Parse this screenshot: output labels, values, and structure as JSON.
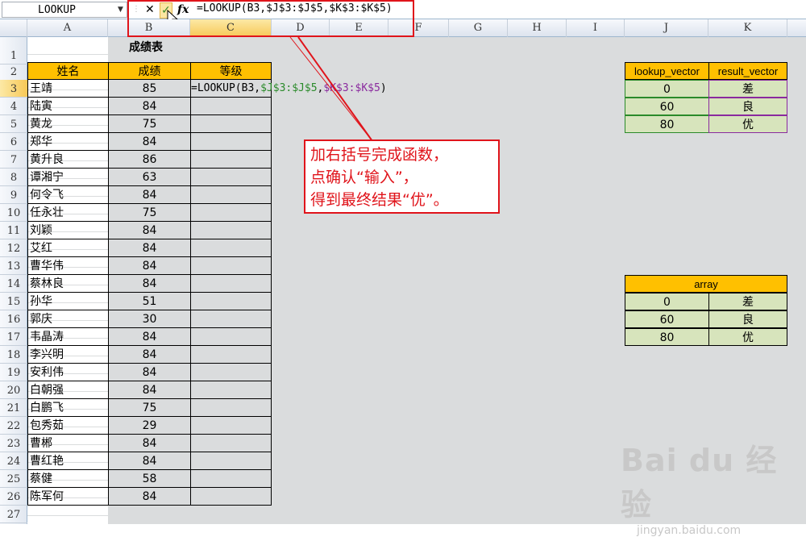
{
  "formula_bar": {
    "name_box": "LOOKUP",
    "formula_prefix": "=LOOKUP(B3,",
    "formula_ref1": "$J$3:$J$5",
    "formula_sep": ",",
    "formula_ref2": "$K$3:$K$5",
    "formula_suffix": ")",
    "tooltip": "输入"
  },
  "columns": [
    "A",
    "B",
    "C",
    "D",
    "E",
    "F",
    "G",
    "H",
    "I",
    "J",
    "K"
  ],
  "rows": [
    "1",
    "2",
    "3",
    "4",
    "5",
    "6",
    "7",
    "8",
    "9",
    "10",
    "11",
    "12",
    "13",
    "14",
    "15",
    "16",
    "17",
    "18",
    "19",
    "20",
    "21",
    "22",
    "23",
    "24",
    "25",
    "26",
    "27"
  ],
  "title": "成绩表",
  "table_headers": [
    "姓名",
    "成绩",
    "等级"
  ],
  "students": [
    {
      "name": "王靖",
      "score": "85"
    },
    {
      "name": "陆寅",
      "score": "84"
    },
    {
      "name": "黄龙",
      "score": "75"
    },
    {
      "name": "郑华",
      "score": "84"
    },
    {
      "name": "黄升良",
      "score": "86"
    },
    {
      "name": "谭湘宁",
      "score": "63"
    },
    {
      "name": "何令飞",
      "score": "84"
    },
    {
      "name": "任永壮",
      "score": "75"
    },
    {
      "name": "刘颖",
      "score": "84"
    },
    {
      "name": "艾红",
      "score": "84"
    },
    {
      "name": "曹华伟",
      "score": "84"
    },
    {
      "name": "蔡林良",
      "score": "84"
    },
    {
      "name": "孙华",
      "score": "51"
    },
    {
      "name": "郭庆",
      "score": "30"
    },
    {
      "name": "韦晶涛",
      "score": "84"
    },
    {
      "name": "李兴明",
      "score": "84"
    },
    {
      "name": "安利伟",
      "score": "84"
    },
    {
      "name": "白朝强",
      "score": "84"
    },
    {
      "name": "白鹏飞",
      "score": "75"
    },
    {
      "name": "包秀茹",
      "score": "29"
    },
    {
      "name": "曹郴",
      "score": "84"
    },
    {
      "name": "曹红艳",
      "score": "84"
    },
    {
      "name": "蔡健",
      "score": "58"
    },
    {
      "name": "陈军何",
      "score": "84"
    }
  ],
  "editing_cell": {
    "prefix": "=LOOKUP(B3,",
    "ref1": "$J$3:$J$5",
    "sep": ",",
    "ref2": "$K$3:$K$5",
    "suffix": ")"
  },
  "lookup_table": {
    "header_vector": "lookup_vector",
    "header_result": "result_vector",
    "rows": [
      [
        "0",
        "差"
      ],
      [
        "60",
        "良"
      ],
      [
        "80",
        "优"
      ]
    ]
  },
  "array_table": {
    "header": "array",
    "rows": [
      [
        "0",
        "差"
      ],
      [
        "60",
        "良"
      ],
      [
        "80",
        "优"
      ]
    ]
  },
  "callout": {
    "line1": "加右括号完成函数，",
    "line2": "点确认“输入”，",
    "line3": "得到最终结果“优”。"
  },
  "watermark": {
    "brand": "Bai du 经验",
    "url": "jingyan.baidu.com"
  },
  "colors": {
    "header_fill": "#ffc000",
    "green_fill": "#d7e4bc",
    "callout_red": "#e0141b",
    "ref1": "#2a8a2a",
    "ref2": "#8a2a9e"
  }
}
